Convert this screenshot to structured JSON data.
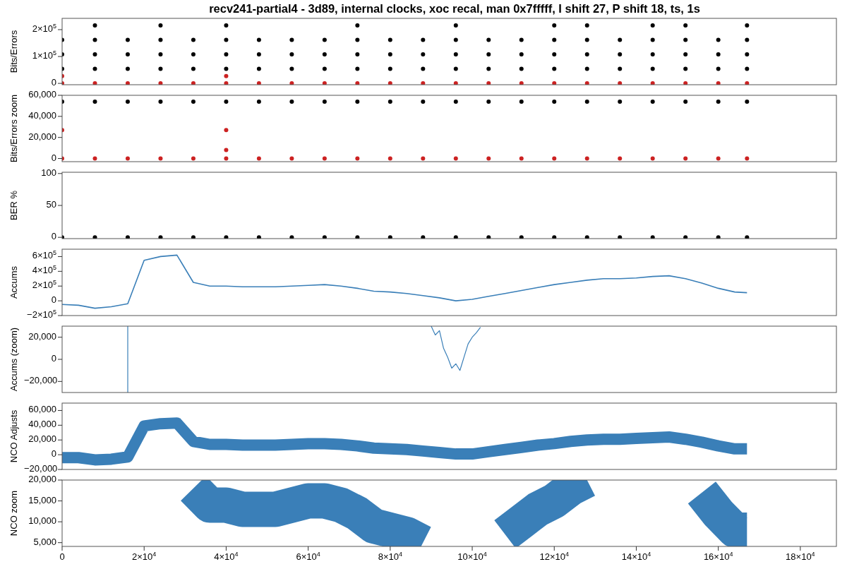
{
  "title": "recv241-partial4 - 3d89, internal clocks, xoc recal, man 0x7fffff, I shift 27, P shift 18, ts, 1s",
  "panels": [
    {
      "chart_data": {
        "type": "scatter",
        "ylabel": "Bits/Errors",
        "xlim": [
          0,
          188800
        ],
        "ylim": [
          -5000,
          242000
        ],
        "yticks": [
          {
            "value": 0,
            "label": "0"
          },
          {
            "value": 100000,
            "label": "1×10$^{5}$"
          },
          {
            "value": 200000,
            "label": "2×10$^{5}$"
          }
        ],
        "x": [
          0,
          8000,
          16000,
          24000,
          32000,
          40000,
          48000,
          56000,
          64000,
          72000,
          80000,
          88000,
          96000,
          104000,
          112000,
          120000,
          128000,
          136000,
          144000,
          152000,
          160000,
          167000
        ],
        "series": [
          {
            "color": "#000000",
            "values": [
              54000,
              54000,
              54000,
              54000,
              54000,
              54000,
              54000,
              54000,
              54000,
              54000,
              54000,
              54000,
              54000,
              54000,
              54000,
              54000,
              54000,
              54000,
              54000,
              54000,
              54000,
              54000
            ]
          },
          {
            "color": "#000000",
            "values": [
              108000,
              108000,
              108000,
              108000,
              108000,
              108000,
              108000,
              108000,
              108000,
              108000,
              108000,
              108000,
              108000,
              108000,
              108000,
              108000,
              108000,
              108000,
              108000,
              108000,
              108000,
              108000
            ]
          },
          {
            "color": "#000000",
            "values": [
              162000,
              162000,
              162000,
              162000,
              162000,
              162000,
              162000,
              162000,
              162000,
              162000,
              162000,
              162000,
              162000,
              162000,
              162000,
              162000,
              162000,
              162000,
              162000,
              162000,
              162000,
              162000
            ]
          },
          {
            "color": "#000000",
            "values": [
              null,
              216000,
              null,
              216000,
              null,
              216000,
              null,
              null,
              null,
              216000,
              null,
              null,
              216000,
              null,
              null,
              216000,
              216000,
              null,
              216000,
              216000,
              null,
              216000
            ]
          },
          {
            "color": "#cc2222",
            "values": [
              0,
              0,
              0,
              0,
              0,
              0,
              0,
              0,
              0,
              0,
              0,
              0,
              0,
              0,
              0,
              0,
              0,
              0,
              0,
              0,
              0,
              0
            ]
          },
          {
            "color": "#cc2222",
            "values": [
              27000,
              null,
              null,
              null,
              null,
              27000,
              null,
              null,
              null,
              null,
              null,
              null,
              null,
              null,
              null,
              null,
              null,
              null,
              null,
              null,
              null,
              null
            ]
          }
        ]
      }
    },
    {
      "chart_data": {
        "type": "scatter",
        "ylabel": "Bits/Errors zoom",
        "xlim": [
          0,
          188800
        ],
        "ylim": [
          -3000,
          60000
        ],
        "yticks": [
          {
            "value": 0,
            "label": "0"
          },
          {
            "value": 20000,
            "label": "20,000"
          },
          {
            "value": 40000,
            "label": "40,000"
          },
          {
            "value": 60000,
            "label": "60,000"
          }
        ],
        "x": [
          0,
          8000,
          16000,
          24000,
          32000,
          40000,
          48000,
          56000,
          64000,
          72000,
          80000,
          88000,
          96000,
          104000,
          112000,
          120000,
          128000,
          136000,
          144000,
          152000,
          160000,
          167000
        ],
        "series": [
          {
            "color": "#000000",
            "values": [
              54000,
              54000,
              54000,
              54000,
              54000,
              54000,
              54000,
              54000,
              54000,
              54000,
              54000,
              54000,
              54000,
              54000,
              54000,
              54000,
              54000,
              54000,
              54000,
              54000,
              54000,
              54000
            ]
          },
          {
            "color": "#cc2222",
            "values": [
              0,
              0,
              0,
              0,
              0,
              0,
              0,
              0,
              0,
              0,
              0,
              0,
              0,
              0,
              0,
              0,
              0,
              0,
              0,
              0,
              0,
              0
            ]
          },
          {
            "color": "#cc2222",
            "values": [
              27000,
              null,
              null,
              null,
              null,
              27000,
              null,
              null,
              null,
              null,
              null,
              null,
              null,
              null,
              null,
              null,
              null,
              null,
              null,
              null,
              null,
              null
            ]
          },
          {
            "color": "#cc2222",
            "values": [
              null,
              null,
              null,
              null,
              null,
              8000,
              null,
              null,
              null,
              null,
              null,
              null,
              null,
              null,
              null,
              null,
              null,
              null,
              null,
              null,
              null,
              null
            ]
          }
        ]
      }
    },
    {
      "chart_data": {
        "type": "scatter",
        "ylabel": "BER %",
        "xlim": [
          0,
          188800
        ],
        "ylim": [
          -2,
          102
        ],
        "yticks": [
          {
            "value": 0,
            "label": "0"
          },
          {
            "value": 50,
            "label": "50"
          },
          {
            "value": 100,
            "label": "100"
          }
        ],
        "x": [
          0,
          8000,
          16000,
          24000,
          32000,
          40000,
          48000,
          56000,
          64000,
          72000,
          80000,
          88000,
          96000,
          104000,
          112000,
          120000,
          128000,
          136000,
          144000,
          152000,
          160000,
          167000
        ],
        "series": [
          {
            "color": "#000000",
            "values": [
              0,
              0,
              0,
              0,
              0,
              0,
              0,
              0,
              0,
              0,
              0,
              0,
              0,
              0,
              0,
              0,
              0,
              0,
              0,
              0,
              0,
              0
            ]
          }
        ]
      }
    },
    {
      "chart_data": {
        "type": "line",
        "ylabel": "Accums",
        "xlim": [
          0,
          188800
        ],
        "ylim": [
          -200000,
          700000
        ],
        "yticks": [
          {
            "value": -200000,
            "label": "−2×10$^{5}$"
          },
          {
            "value": 0,
            "label": "0"
          },
          {
            "value": 200000,
            "label": "2×10$^{5}$"
          },
          {
            "value": 400000,
            "label": "4×10$^{5}$"
          },
          {
            "value": 600000,
            "label": "6×10$^{5}$"
          }
        ],
        "x": [
          0,
          4000,
          8000,
          12000,
          16000,
          20000,
          24000,
          28000,
          32000,
          36000,
          40000,
          44000,
          48000,
          52000,
          56000,
          60000,
          64000,
          68000,
          72000,
          76000,
          80000,
          84000,
          88000,
          92000,
          96000,
          100000,
          104000,
          108000,
          112000,
          116000,
          120000,
          124000,
          128000,
          132000,
          136000,
          140000,
          144000,
          148000,
          152000,
          156000,
          160000,
          164000,
          167000
        ],
        "series": [
          {
            "color": "#3a7fb8",
            "values": [
              -50000,
              -60000,
              -100000,
              -80000,
              -40000,
              550000,
              600000,
              620000,
              250000,
              200000,
              200000,
              190000,
              190000,
              190000,
              200000,
              210000,
              220000,
              200000,
              170000,
              130000,
              120000,
              100000,
              70000,
              40000,
              0,
              20000,
              60000,
              100000,
              140000,
              180000,
              220000,
              250000,
              280000,
              300000,
              300000,
              310000,
              330000,
              340000,
              300000,
              240000,
              170000,
              120000,
              110000
            ]
          }
        ]
      }
    },
    {
      "chart_data": {
        "type": "line",
        "ylabel": "Accums (zoom)",
        "xlim": [
          0,
          188800
        ],
        "ylim": [
          -30000,
          30000
        ],
        "yticks": [
          {
            "value": -20000,
            "label": "−20,000"
          },
          {
            "value": 0,
            "label": "0"
          },
          {
            "value": 20000,
            "label": "20,000"
          }
        ],
        "x": [
          16000,
          16000,
          90000,
          91000,
          92000,
          93000,
          94000,
          95000,
          96000,
          97000,
          98000,
          99000,
          100000,
          101000,
          102000
        ],
        "series": [
          {
            "color": "#3a7fb8",
            "values": [
              -30000,
              30000,
              null,
              null,
              null,
              null,
              null,
              null,
              null,
              null,
              null,
              null,
              null,
              null,
              null
            ]
          },
          {
            "color": "#3a7fb8",
            "values": [
              null,
              null,
              30000,
              22000,
              26000,
              10000,
              2000,
              -8000,
              -4000,
              -10000,
              2000,
              14000,
              20000,
              24000,
              29000
            ]
          }
        ]
      }
    },
    {
      "chart_data": {
        "type": "line",
        "ylabel": "NCO Adjusts",
        "xlim": [
          0,
          188800
        ],
        "ylim": [
          -20000,
          70000
        ],
        "yticks": [
          {
            "value": -20000,
            "label": "−20,000"
          },
          {
            "value": 0,
            "label": "0"
          },
          {
            "value": 20000,
            "label": "20,000"
          },
          {
            "value": 40000,
            "label": "40,000"
          },
          {
            "value": 60000,
            "label": "60,000"
          }
        ],
        "x": [
          0,
          4000,
          8000,
          12000,
          16000,
          20000,
          24000,
          28000,
          32000,
          36000,
          40000,
          44000,
          48000,
          52000,
          56000,
          60000,
          64000,
          68000,
          72000,
          76000,
          80000,
          84000,
          88000,
          92000,
          96000,
          100000,
          104000,
          108000,
          112000,
          116000,
          120000,
          124000,
          128000,
          132000,
          136000,
          140000,
          144000,
          148000,
          152000,
          156000,
          160000,
          164000,
          167000
        ],
        "series": [
          {
            "color": "#3a7fb8",
            "values": [
              -4000,
              -4000,
              -7000,
              -6000,
              -3000,
              39000,
              42000,
              43000,
              18000,
              14000,
              14000,
              13000,
              13000,
              13000,
              14000,
              15000,
              15000,
              14000,
              12000,
              9000,
              8000,
              7000,
              5000,
              3000,
              1000,
              1000,
              4000,
              7000,
              10000,
              13000,
              15000,
              18000,
              20000,
              21000,
              21000,
              22000,
              23000,
              24000,
              21000,
              17000,
              12000,
              8000,
              8000
            ]
          }
        ]
      }
    },
    {
      "chart_data": {
        "type": "line",
        "ylabel": "NCO zoom",
        "xlim": [
          0,
          188800
        ],
        "ylim": [
          4100,
          20000
        ],
        "yticks": [
          {
            "value": 5000,
            "label": "5,000"
          },
          {
            "value": 10000,
            "label": "10,000"
          },
          {
            "value": 15000,
            "label": "15,000"
          },
          {
            "value": 20000,
            "label": "20,000"
          }
        ],
        "xticks": [
          {
            "value": 0,
            "label": "0"
          },
          {
            "value": 20000,
            "label": "2×10$^{4}$"
          },
          {
            "value": 40000,
            "label": "4×10$^{4}$"
          },
          {
            "value": 60000,
            "label": "6×10$^{4}$"
          },
          {
            "value": 80000,
            "label": "8×10$^{4}$"
          },
          {
            "value": 100000,
            "label": "10×10$^{4}$"
          },
          {
            "value": 120000,
            "label": "12×10$^{4}$"
          },
          {
            "value": 140000,
            "label": "14×10$^{4}$"
          },
          {
            "value": 160000,
            "label": "16×10$^{4}$"
          },
          {
            "value": 180000,
            "label": "18×10$^{4}$"
          }
        ],
        "x": [
          32000,
          36000,
          40000,
          44000,
          48000,
          52000,
          56000,
          60000,
          64000,
          68000,
          72000,
          76000,
          80000,
          84000,
          88000,
          92000,
          96000,
          100000,
          104000,
          108000,
          112000,
          116000,
          120000,
          124000,
          128000,
          132000,
          136000,
          140000,
          144000,
          148000,
          152000,
          156000,
          160000,
          164000,
          167000
        ],
        "series": [
          {
            "color": "#3a7fb8",
            "values": [
              18000,
              14000,
              14000,
              13000,
              13000,
              13000,
              14000,
              15000,
              15000,
              14000,
              12000,
              9000,
              8000,
              7000,
              5000,
              null,
              null,
              null,
              null,
              7000,
              10000,
              13000,
              15000,
              18000,
              20000,
              null,
              null,
              null,
              null,
              null,
              null,
              17000,
              12000,
              8000,
              8000
            ]
          }
        ]
      }
    }
  ]
}
